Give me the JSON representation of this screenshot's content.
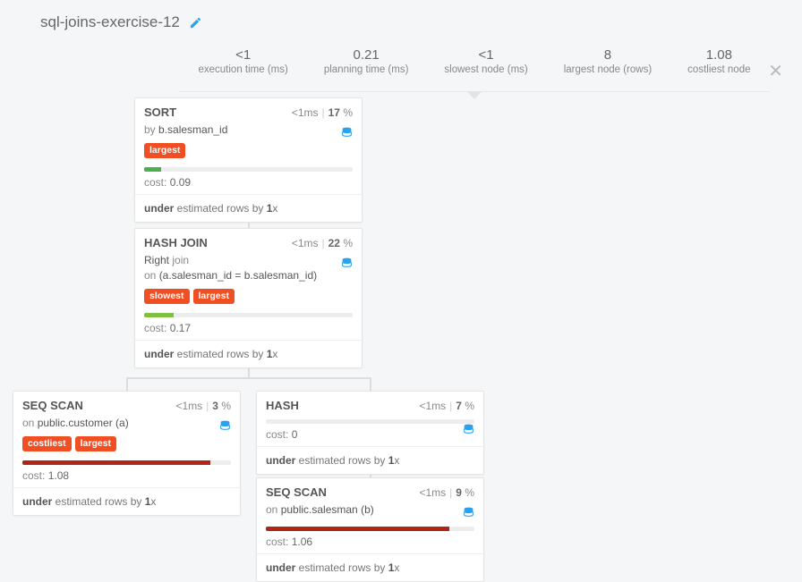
{
  "title": "sql-joins-exercise-12",
  "stats": [
    {
      "value": "<1",
      "label": "execution time (ms)"
    },
    {
      "value": "0.21",
      "label": "planning time (ms)"
    },
    {
      "value": "<1",
      "label": "slowest node (ms)"
    },
    {
      "value": "8",
      "label": "largest node (rows)"
    },
    {
      "value": "1.08",
      "label": "costliest node"
    }
  ],
  "nodes": {
    "sort": {
      "op": "SORT",
      "time": "<1ms",
      "pct": "17",
      "desc_prefix": "by ",
      "desc_strong": "b.salesman_id",
      "tags": [
        "largest"
      ],
      "bar_color": "#4CAF50",
      "bar_width": "8%",
      "cost": "0.09",
      "foot_b1": "under",
      "foot_mid": " estimated rows by ",
      "foot_b2": "1",
      "foot_suffix": "x"
    },
    "hashjoin": {
      "op": "HASH JOIN",
      "time": "<1ms",
      "pct": "22",
      "line1_strong": "Right",
      "line1_rest": " join",
      "line2_pre": "on ",
      "line2_strong": "(a.salesman_id = b.salesman_id)",
      "tags": [
        "slowest",
        "largest"
      ],
      "bar_color": "#7fc241",
      "bar_width": "14%",
      "cost": "0.17",
      "foot_b1": "under",
      "foot_mid": " estimated rows by ",
      "foot_b2": "1",
      "foot_suffix": "x"
    },
    "seqscan_customer": {
      "op": "SEQ SCAN",
      "time": "<1ms",
      "pct": "3",
      "desc_pre": "on ",
      "desc_strong": "public.customer (a)",
      "tags": [
        "costliest",
        "largest"
      ],
      "bar_color": "#b12418",
      "bar_width": "90%",
      "cost": "1.08",
      "foot_b1": "under",
      "foot_mid": " estimated rows by ",
      "foot_b2": "1",
      "foot_suffix": "x"
    },
    "hash": {
      "op": "HASH",
      "time": "<1ms",
      "pct": "7",
      "bar_color": "#eceded",
      "bar_width": "0%",
      "cost": "0",
      "foot_b1": "under",
      "foot_mid": " estimated rows by ",
      "foot_b2": "1",
      "foot_suffix": "x"
    },
    "seqscan_salesman": {
      "op": "SEQ SCAN",
      "time": "<1ms",
      "pct": "9",
      "desc_pre": "on ",
      "desc_strong": "public.salesman (b)",
      "bar_color": "#b12418",
      "bar_width": "88%",
      "cost": "1.06",
      "foot_b1": "under",
      "foot_mid": " estimated rows by ",
      "foot_b2": "1",
      "foot_suffix": "x"
    }
  },
  "labels": {
    "cost": "cost: ",
    "pct_suffix": " %"
  }
}
